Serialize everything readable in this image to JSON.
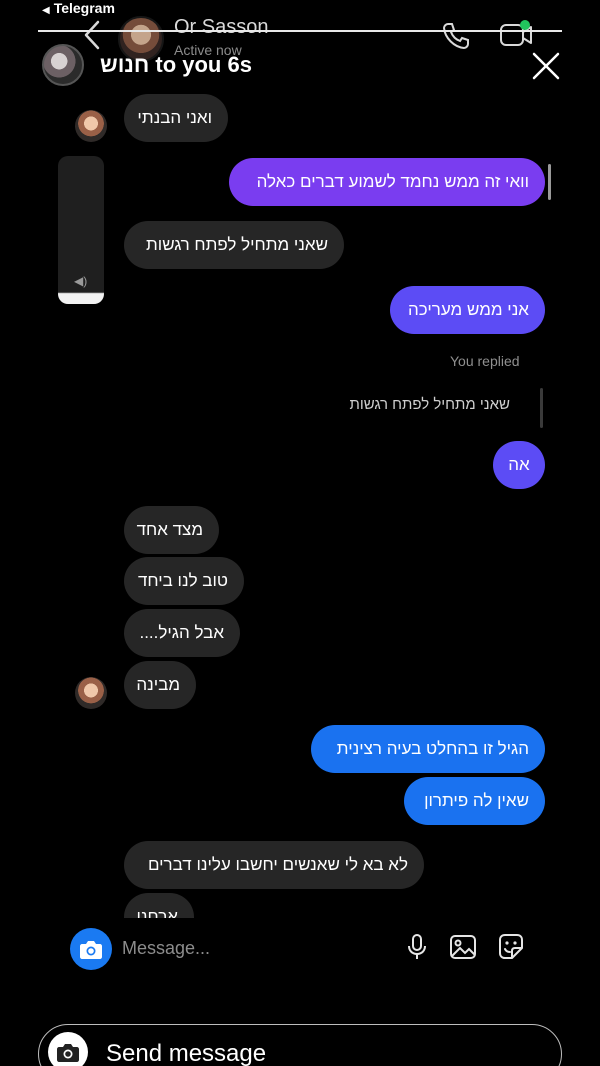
{
  "status_bar": {
    "back_label": "Telegram"
  },
  "dm_header": {
    "name": "Or Sasson",
    "status": "Active now"
  },
  "story_header": {
    "title": "חנוש to you  6s"
  },
  "messages": {
    "m1": "ואני הבנתי",
    "m2": "וואי זה ממש נחמד לשמוע דברים כאלה",
    "m3": "שאני מתחיל לפתח רגשות",
    "m4": "אני ממש מעריכה",
    "you_replied": "You replied",
    "quoted": "שאני מתחיל לפתח רגשות",
    "m5": "אה",
    "m6": "מצד אחד",
    "m7": "טוב לנו ביחד",
    "m8": "אבל הגיל....",
    "m9": "מבינה",
    "m10": "הגיל זו בהחלט בעיה רצינית",
    "m11": "שאין לה פיתרון",
    "m12": "לא בא לי שאנשים יחשבו עלינו דברים",
    "m13": "ארחנו"
  },
  "composer": {
    "placeholder": "Message..."
  },
  "send_bar": {
    "label": "Send message"
  },
  "colors": {
    "incoming": "#262626",
    "outgoing_purple": "#7a3df0",
    "outgoing_violet": "#5c4cf5",
    "outgoing_blue": "#1a72f0"
  }
}
